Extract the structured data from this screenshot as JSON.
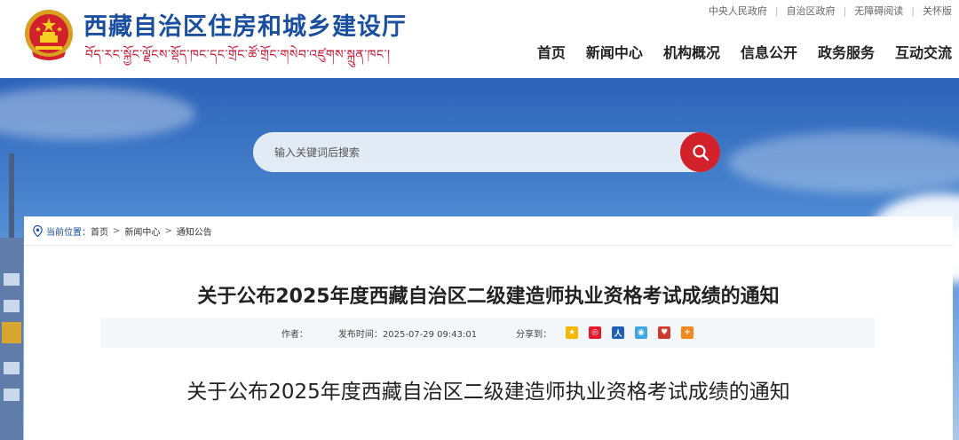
{
  "site": {
    "title": "西藏自治区住房和城乡建设厅",
    "subtitle_tibetan": "བོད་རང་སྐྱོང་ལྗོངས་སྡོད་ཁང་དང་གྲོང་ཚོ་གྲོང་གསེབ་འཛུགས་སྐྲུན་ཁང་།"
  },
  "toplinks": [
    "中央人民政府",
    "自治区政府",
    "无障碍阅读",
    "关怀版"
  ],
  "nav": [
    "首页",
    "新闻中心",
    "机构概况",
    "信息公开",
    "政务服务",
    "互动交流"
  ],
  "search": {
    "placeholder": "输入关键词后搜索"
  },
  "breadcrumb": {
    "label": "当前位置：",
    "items": [
      "首页",
      "新闻中心",
      "通知公告"
    ],
    "separator": ">"
  },
  "article": {
    "title": "关于公布2025年度西藏自治区二级建造师执业资格考试成绩的通知",
    "author_label": "作者：",
    "publish_label": "发布时间：2025-07-29 09:43:01",
    "share_label": "分享到：",
    "body_title": "关于公布2025年度西藏自治区二级建造师执业资格考试成绩的通知"
  },
  "share_icons": [
    {
      "name": "qzone-icon",
      "color": "#f5b700"
    },
    {
      "name": "weibo-icon",
      "color": "#e6162d"
    },
    {
      "name": "renren-icon",
      "color": "#1d5fb2"
    },
    {
      "name": "tencent-weibo-icon",
      "color": "#3ea6e0"
    },
    {
      "name": "baidu-icon",
      "color": "#d03a2c"
    },
    {
      "name": "more-icon",
      "color": "#f08a1c"
    }
  ],
  "colors": {
    "brand_blue": "#1a4fa0",
    "brand_red": "#c8102e",
    "search_button": "#d3212b"
  }
}
